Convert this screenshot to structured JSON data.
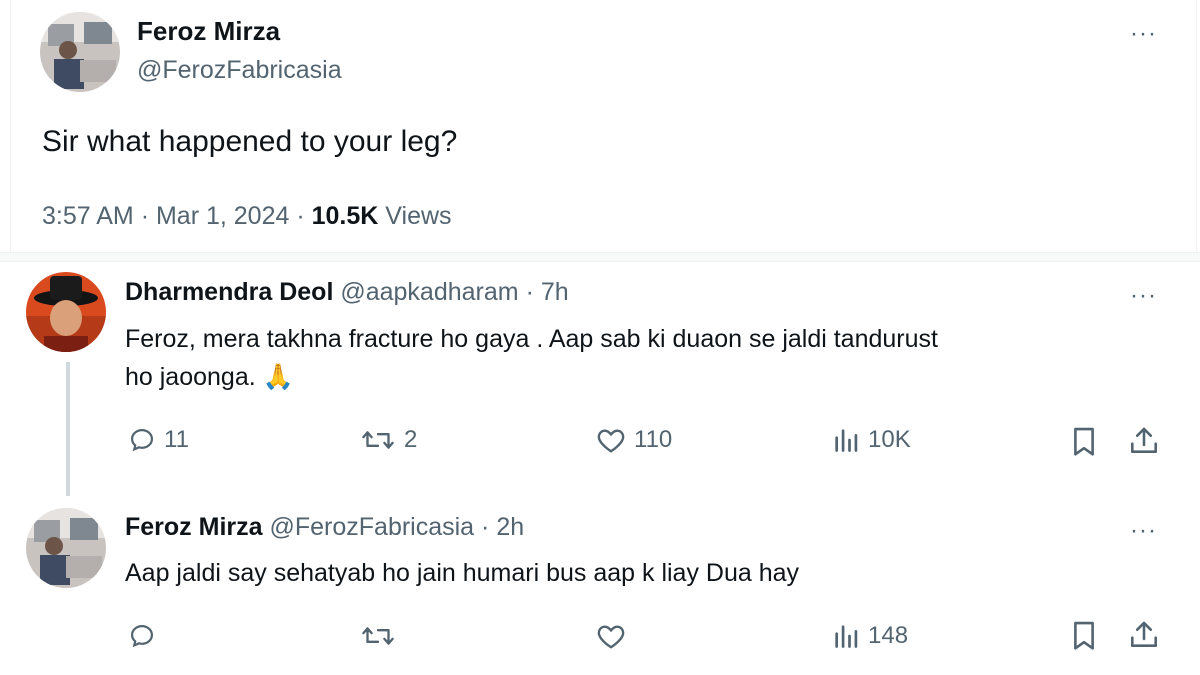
{
  "main_tweet": {
    "author_name": "Feroz Mirza",
    "handle": "@FerozFabricasia",
    "text": "Sir what happened to your leg?",
    "time": "3:57 AM",
    "sep1": "·",
    "date": "Mar 1, 2024",
    "sep2": "·",
    "views_count": "10.5K",
    "views_label": "Views",
    "more": "···"
  },
  "replies": [
    {
      "author_name": "Dharmendra Deol",
      "handle": "@aapkadharam",
      "sep": "·",
      "age": "7h",
      "text_line1": "Feroz,  mera takhna fracture ho gaya . Aap sab ki duaon se jaldi tandurust",
      "text_line2": "ho jaoonga. 🙏",
      "replies_count": "11",
      "reposts_count": "2",
      "likes_count": "110",
      "views_count": "10K",
      "more": "···"
    },
    {
      "author_name": "Feroz Mirza",
      "handle": "@FerozFabricasia",
      "sep": "·",
      "age": "2h",
      "text_line1": "Aap jaldi say sehatyab ho jain humari bus aap k liay Dua hay",
      "replies_count": "",
      "reposts_count": "",
      "likes_count": "",
      "views_count": "148",
      "more": "···"
    }
  ],
  "icons": {
    "reply": "reply-icon",
    "repost": "repost-icon",
    "like": "like-icon",
    "views": "views-icon",
    "bookmark": "bookmark-icon",
    "share": "share-icon"
  },
  "colors": {
    "text": "#0f1419",
    "muted": "#536471",
    "border": "#eff3f4",
    "thread_line": "#cfd9de"
  }
}
